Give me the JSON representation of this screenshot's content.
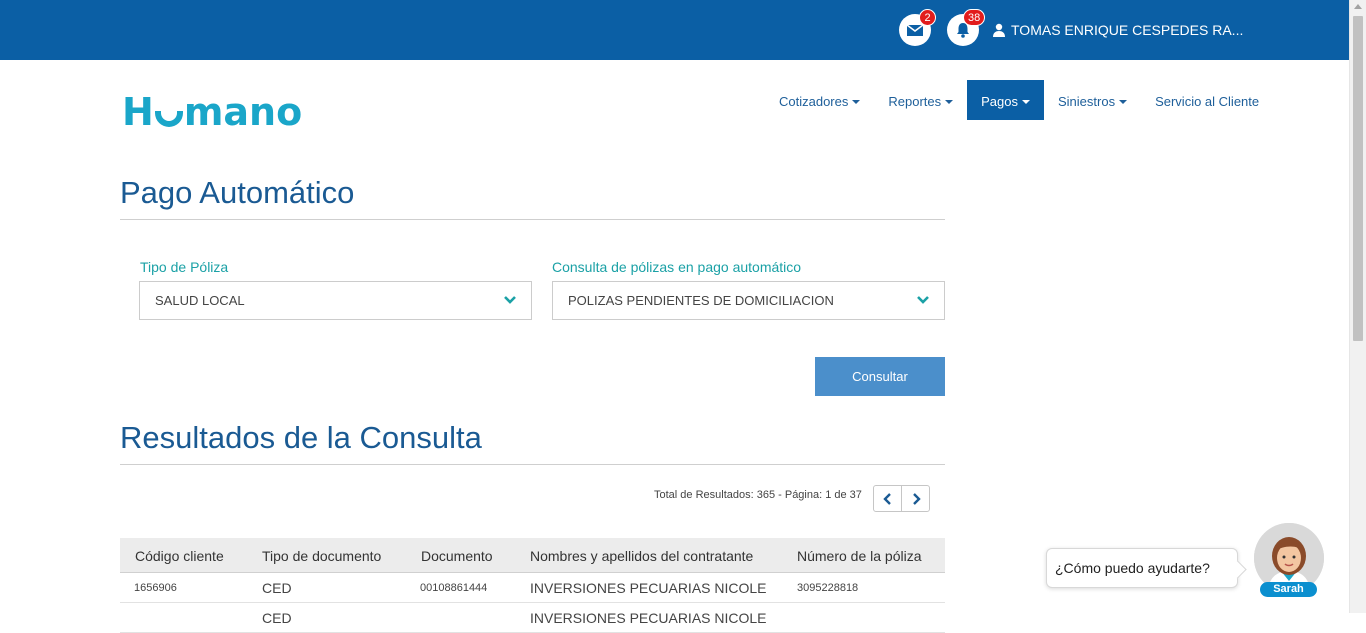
{
  "topbar": {
    "mail_badge": "2",
    "bell_badge": "38",
    "user_name": "TOMAS ENRIQUE CESPEDES RA..."
  },
  "logo": {
    "part1": "H",
    "part2": "mano"
  },
  "nav": {
    "items": [
      {
        "label": "Cotizadores",
        "caret": true
      },
      {
        "label": "Reportes",
        "caret": true
      },
      {
        "label": "Pagos",
        "caret": true,
        "active": true
      },
      {
        "label": "Siniestros",
        "caret": true
      },
      {
        "label": "Servicio al Cliente",
        "caret": false
      }
    ]
  },
  "page": {
    "title": "Pago Automático",
    "results_title": "Resultados de la Consulta"
  },
  "filters": {
    "tipo_poliza_label": "Tipo de Póliza",
    "tipo_poliza_value": "SALUD LOCAL",
    "consulta_label": "Consulta de pólizas en pago automático",
    "consulta_value": "POLIZAS PENDIENTES DE DOMICILIACION",
    "submit_label": "Consultar"
  },
  "results": {
    "summary": "Total de Resultados: 365 - Página: 1 de 37",
    "columns": [
      "Código cliente",
      "Tipo de documento",
      "Documento",
      "Nombres y apellidos del contratante",
      "Número de la póliza"
    ],
    "rows": [
      [
        "1656906",
        "CED",
        "00108861444",
        "INVERSIONES PECUARIAS NICOLE",
        "3095228818"
      ],
      [
        "",
        "CED",
        "",
        "INVERSIONES PECUARIAS NICOLE",
        ""
      ]
    ]
  },
  "chat": {
    "prompt": "¿Cómo puedo ayudarte?",
    "assistant_name": "Sarah"
  },
  "colors": {
    "primary": "#0b5fa5",
    "accent": "#1ba1a6",
    "button": "#4b8fcb",
    "logo": "#1aa6c9"
  }
}
